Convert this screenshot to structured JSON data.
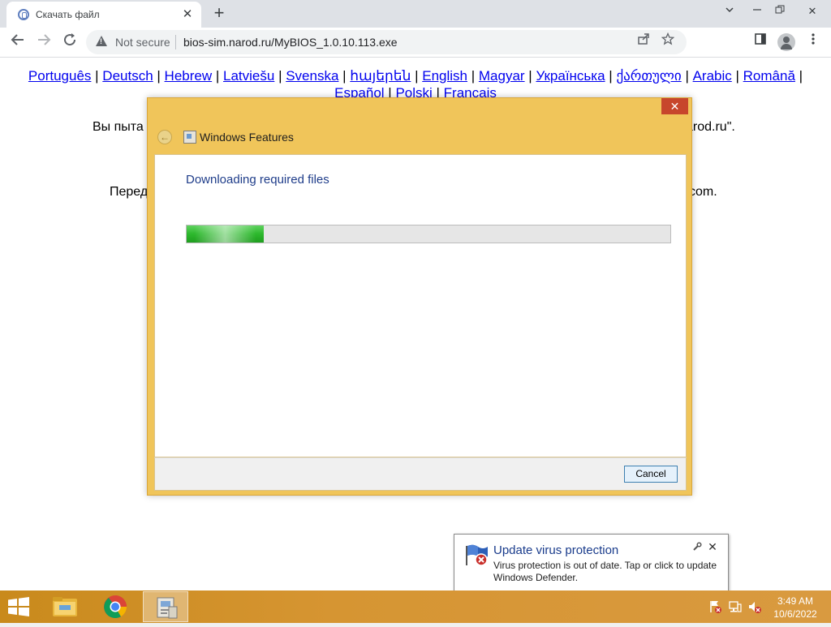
{
  "browser": {
    "tab_title": "Скачать файл",
    "new_tab_symbol": "+",
    "close_symbol": "✕",
    "security_label": "Not secure",
    "url": "bios-sim.narod.ru/MyBIOS_1.0.10.113.exe",
    "icons": [
      "back-arrow-icon",
      "forward-arrow-icon",
      "reload-icon",
      "warning-icon",
      "share-icon",
      "bookmark-star-icon",
      "sidebar-icon",
      "profile-icon",
      "tab-search-icon",
      "minimize-icon",
      "restore-icon",
      "window-close-icon"
    ]
  },
  "page": {
    "languages": [
      "Português",
      "Deutsch",
      "Hebrew",
      "Latviešu",
      "Svenska",
      "հայերեն",
      "English",
      "Magyar",
      "Українська",
      "ქართული",
      "Arabic",
      "Română",
      "Español",
      "Polski",
      "Français"
    ],
    "line1_left": "Вы пыта",
    "line1_right": "arod.ru\".",
    "line2_left": "Перед",
    "line2_right": "com."
  },
  "dialog": {
    "title": "Windows Features",
    "heading": "Downloading required files",
    "progress": 0.16,
    "cancel_label": "Cancel",
    "close_symbol": "✕"
  },
  "notification": {
    "title": "Update virus protection",
    "text": "Virus protection is out of date. Tap or click to update Windows Defender.",
    "close_symbol": "✕"
  },
  "taskbar": {
    "items": [
      "file-explorer-icon",
      "chrome-icon",
      "windows-features-icon"
    ],
    "time": "3:49 AM",
    "date": "10/6/2022"
  },
  "colors": {
    "dialog_frame": "#f0c55a",
    "taskbar": "#d69532",
    "progress_fill": "#2db82d",
    "link": "#0000ee"
  }
}
